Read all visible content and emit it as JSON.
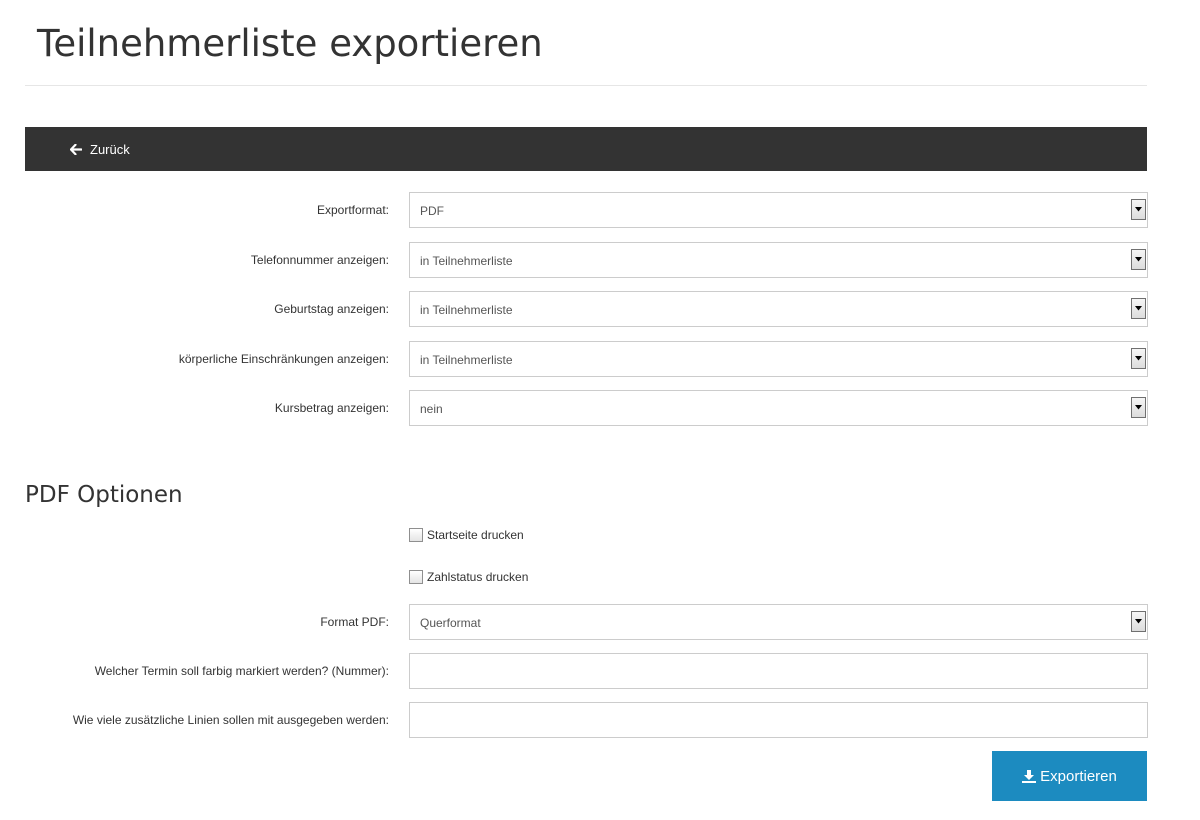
{
  "page": {
    "title": "Teilnehmerliste exportieren"
  },
  "toolbar": {
    "back_label": "Zurück"
  },
  "export_form": {
    "fields": [
      {
        "label": "Exportformat:",
        "value": "PDF"
      },
      {
        "label": "Telefonnummer anzeigen:",
        "value": "in Teilnehmerliste"
      },
      {
        "label": "Geburtstag anzeigen:",
        "value": "in Teilnehmerliste"
      },
      {
        "label": "körperliche Einschränkungen anzeigen:",
        "value": "in Teilnehmerliste"
      },
      {
        "label": "Kursbetrag anzeigen:",
        "value": "nein"
      }
    ]
  },
  "pdf_options": {
    "title": "PDF Optionen",
    "checkboxes": [
      {
        "label": "Startseite drucken",
        "checked": false
      },
      {
        "label": "Zahlstatus drucken",
        "checked": false
      }
    ],
    "format": {
      "label": "Format PDF:",
      "value": "Querformat"
    },
    "highlight_date": {
      "label": "Welcher Termin soll farbig markiert werden? (Nummer):",
      "value": ""
    },
    "extra_lines": {
      "label": "Wie viele zusätzliche Linien sollen mit ausgegeben werden:",
      "value": ""
    }
  },
  "actions": {
    "export_label": "Exportieren"
  },
  "colors": {
    "toolbar_bg": "#333333",
    "primary_button": "#1c8bc0"
  },
  "icons": {
    "back": "arrow-left-icon",
    "export": "download-icon",
    "select": "chevron-down-icon"
  }
}
